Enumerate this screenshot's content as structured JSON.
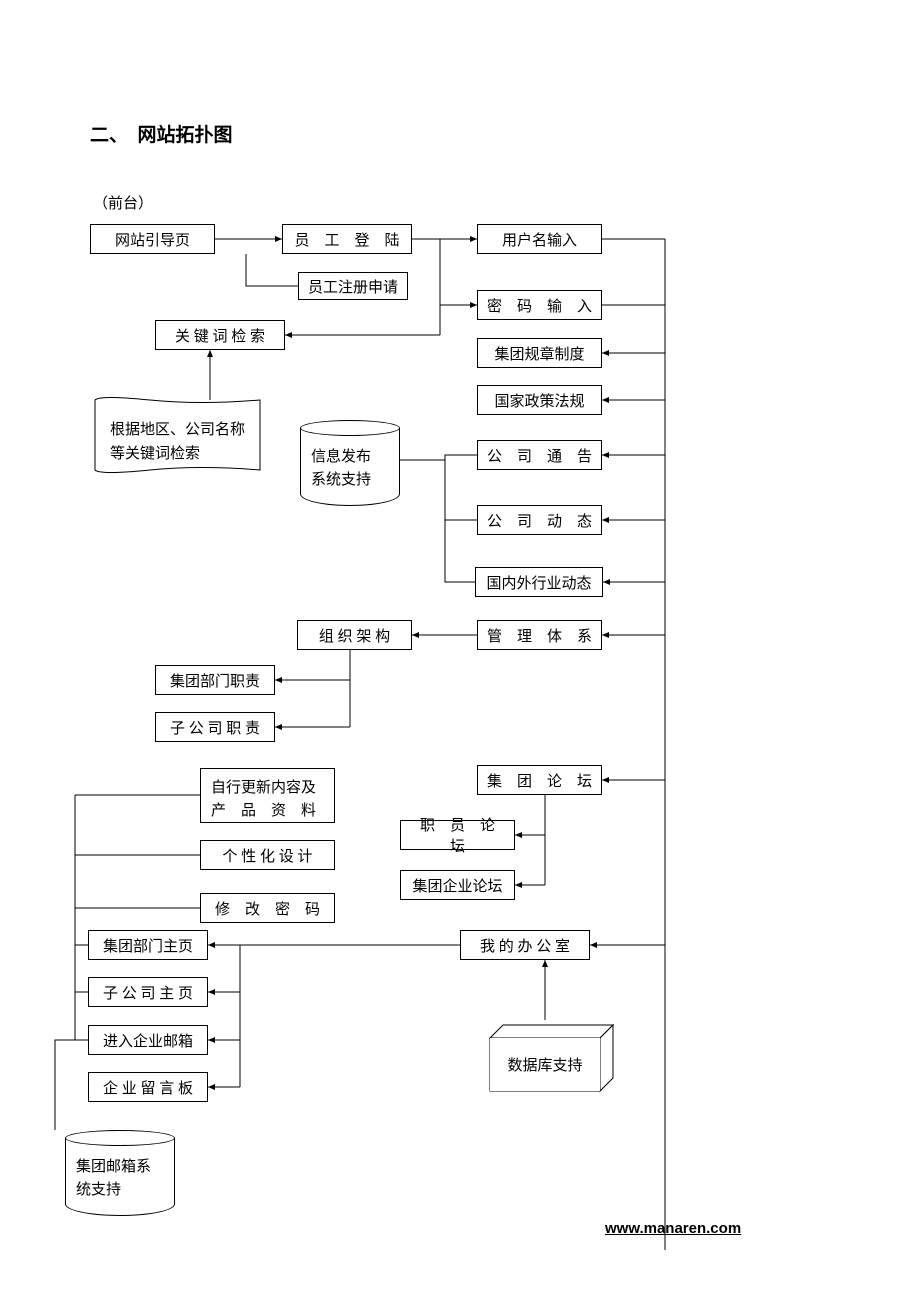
{
  "title": "二、　网站拓扑图",
  "subtitle": "（前台）",
  "boxes": {
    "guide": "网站引导页",
    "emp_login": "员　工　登　陆",
    "emp_register": "员工注册申请",
    "username": "用户名输入",
    "password": "密　码　输　入",
    "keyword": "关 键 词 检 索",
    "rules": "集团规章制度",
    "policy": "国家政策法规",
    "announce": "公　司　通　告",
    "news": "公　司　动　态",
    "industry": "国内外行业动态",
    "org": "组 织 架 构",
    "mgmt": "管　理　体　系",
    "dept_duty": "集团部门职责",
    "sub_duty": "子 公 司 职 责",
    "self_update_l1": "自行更新内容及",
    "self_update_l2": "产　品　资　料",
    "custom": "个 性 化 设 计",
    "changepw": "修　改　密　码",
    "dept_home": "集团部门主页",
    "sub_home": "子 公 司 主 页",
    "mailbox": "进入企业邮箱",
    "msgboard": "企 业 留 言 板",
    "forum": "集　团　论　坛",
    "staff_forum": "职　员　论　坛",
    "corp_forum": "集团企业论坛",
    "office": "我 的 办 公 室"
  },
  "cylinders": {
    "info_sys_l1": "信息发布",
    "info_sys_l2": "系统支持",
    "mail_sys_l1": "集团邮箱系",
    "mail_sys_l2": "统支持"
  },
  "scroll_note_l1": "根据地区、公司名称",
  "scroll_note_l2": "等关键词检索",
  "cube": "数据库支持",
  "footer": "www.manaren.com"
}
